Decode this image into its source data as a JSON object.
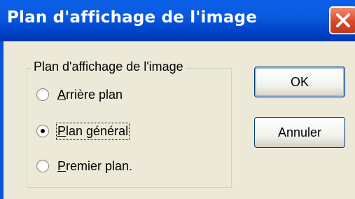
{
  "window": {
    "title": "Plan d'affichage de l'image"
  },
  "group": {
    "title": "Plan d'affichage de l'image",
    "options": [
      {
        "access_key": "A",
        "rest": "rrière plan",
        "selected": false
      },
      {
        "access_key": "P",
        "rest": "lan général",
        "selected": true
      },
      {
        "access_key": "P",
        "rest": "remier plan.",
        "selected": false
      }
    ]
  },
  "buttons": {
    "ok": "OK",
    "cancel": "Annuler"
  },
  "icons": {
    "close": "close-icon"
  }
}
